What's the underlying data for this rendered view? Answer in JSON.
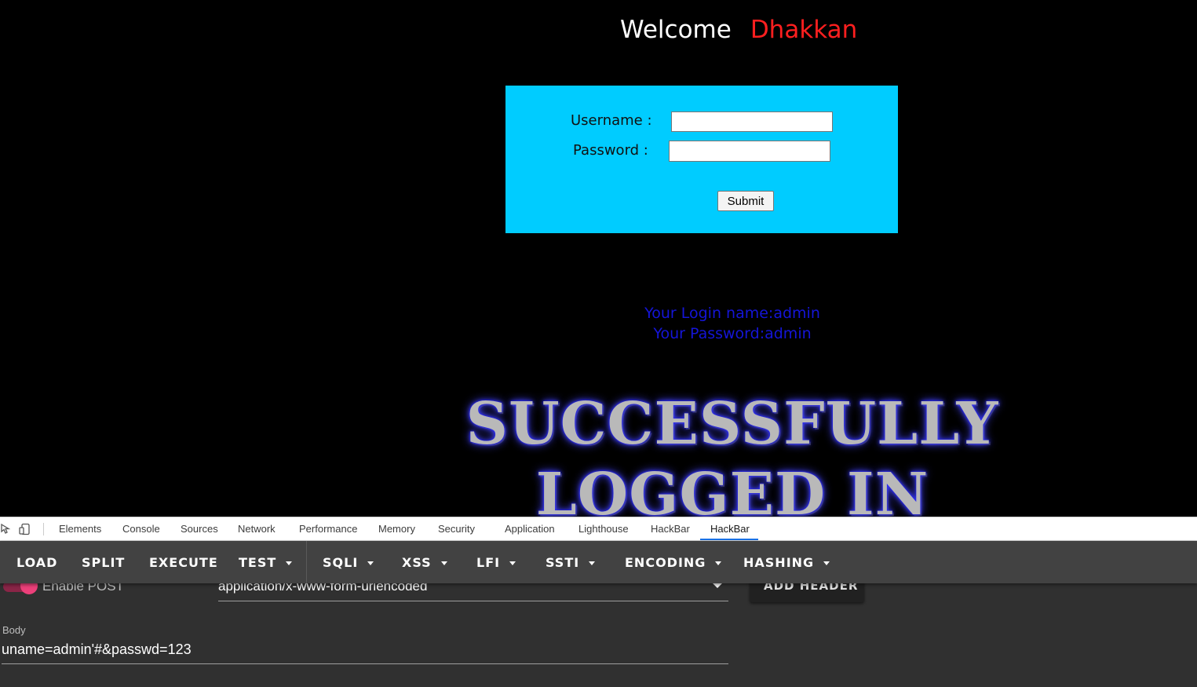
{
  "page": {
    "welcome": "Welcome",
    "user_name": "Dhakkan",
    "form": {
      "username_label": "Username :",
      "password_label": "Password :",
      "username_value": "",
      "password_value": "",
      "submit_label": "Submit"
    },
    "result": {
      "login_name": "Your Login name:admin",
      "password": "Your Password:admin"
    },
    "banner": {
      "line1": "SUCCESSFULLY",
      "line2": "LOGGED IN"
    },
    "colors": {
      "background": "#000000",
      "welcome": "#ffffff",
      "user_name": "#ff1f1f",
      "form_box": "#00ccff",
      "result_text": "#1515d8"
    }
  },
  "devtools": {
    "tool_icons": [
      "inspect-element-icon",
      "device-toolbar-icon"
    ],
    "tabs": [
      "Elements",
      "Console",
      "Sources",
      "Network",
      "Performance",
      "Memory",
      "Security",
      "Application",
      "Lighthouse",
      "HackBar",
      "HackBar"
    ],
    "active_tab": "HackBar"
  },
  "hackbar": {
    "buttons": {
      "load": "LOAD",
      "split": "SPLIT",
      "execute": "EXECUTE",
      "test": "TEST",
      "sqli": "SQLI",
      "xss": "XSS",
      "lfi": "LFI",
      "ssti": "SSTI",
      "encoding": "ENCODING",
      "hashing": "HASHING"
    },
    "enable_post_label": "Enable POST",
    "enable_post_on": true,
    "content_type": "application/x-www-form-urlencoded",
    "add_header_label": "ADD HEADER",
    "body_label": "Body",
    "body_value": "uname=admin'#&passwd=123",
    "colors": {
      "toolbar": "#424242",
      "panel": "#303030",
      "toggle": "#ec407a",
      "active_tab_underline": "#1a73e8"
    }
  }
}
